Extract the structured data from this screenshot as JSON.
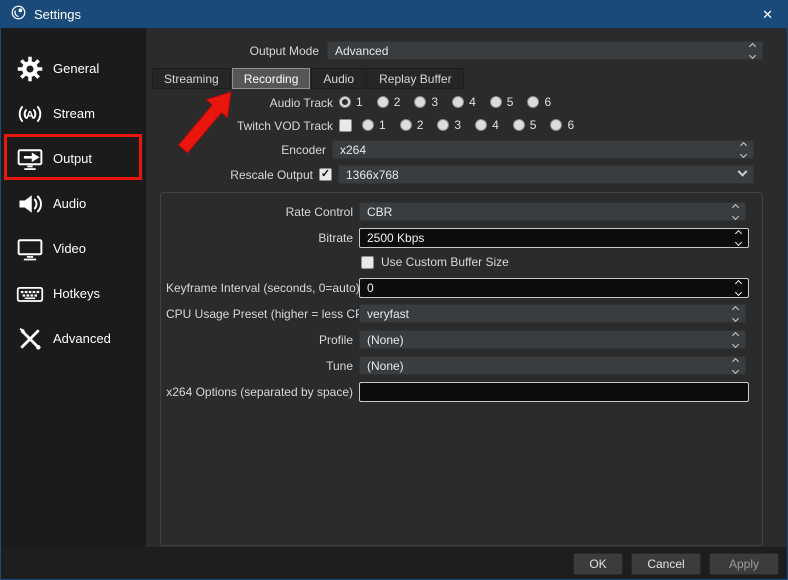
{
  "titlebar": {
    "title": "Settings",
    "close": "✕"
  },
  "sidebar": {
    "items": [
      {
        "label": "General",
        "icon": "gear-icon"
      },
      {
        "label": "Stream",
        "icon": "stream-icon"
      },
      {
        "label": "Output",
        "icon": "output-icon",
        "highlighted": true
      },
      {
        "label": "Audio",
        "icon": "audio-icon"
      },
      {
        "label": "Video",
        "icon": "video-icon"
      },
      {
        "label": "Hotkeys",
        "icon": "hotkeys-icon"
      },
      {
        "label": "Advanced",
        "icon": "advanced-icon"
      }
    ]
  },
  "output_mode": {
    "label": "Output Mode",
    "value": "Advanced"
  },
  "tabs": [
    {
      "label": "Streaming",
      "active": false
    },
    {
      "label": "Recording",
      "active": true
    },
    {
      "label": "Audio",
      "active": false
    },
    {
      "label": "Replay Buffer",
      "active": false
    }
  ],
  "audio_track": {
    "label": "Audio Track",
    "options": [
      "1",
      "2",
      "3",
      "4",
      "5",
      "6"
    ],
    "selected": "1"
  },
  "twitch_vod": {
    "label": "Twitch VOD Track",
    "checkbox_checked": false,
    "options": [
      "1",
      "2",
      "3",
      "4",
      "5",
      "6"
    ],
    "selected": null
  },
  "encoder": {
    "label": "Encoder",
    "value": "x264"
  },
  "rescale": {
    "label": "Rescale Output",
    "checked": true,
    "value": "1366x768"
  },
  "advanced_section": {
    "rate_control": {
      "label": "Rate Control",
      "value": "CBR"
    },
    "bitrate": {
      "label": "Bitrate",
      "value": "2500 Kbps"
    },
    "custom_buffer": {
      "label": "Use Custom Buffer Size",
      "checked": false
    },
    "keyframe": {
      "label": "Keyframe Interval (seconds, 0=auto)",
      "value": "0"
    },
    "cpu_preset": {
      "label": "CPU Usage Preset (higher = less CPU)",
      "value": "veryfast"
    },
    "profile": {
      "label": "Profile",
      "value": "(None)"
    },
    "tune": {
      "label": "Tune",
      "value": "(None)"
    },
    "x264_options": {
      "label": "x264 Options (separated by space)",
      "value": ""
    }
  },
  "footer": {
    "ok": "OK",
    "cancel": "Cancel",
    "apply": "Apply"
  },
  "colors": {
    "titlebar": "#1a4a7a",
    "sidebar_bg": "#1b1b1b",
    "main_bg": "#2b2b2b",
    "annotation": "#e8160c"
  }
}
